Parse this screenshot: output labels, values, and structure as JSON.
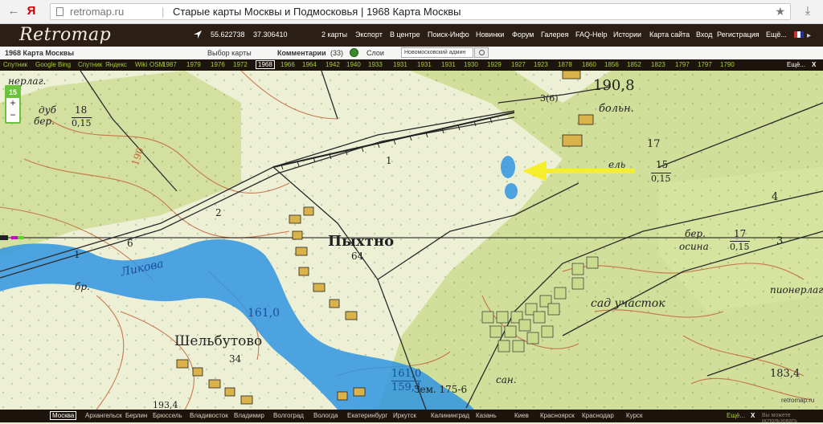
{
  "browser": {
    "back": "←",
    "yandex_logo": "Я",
    "refresh": "↻",
    "domain": "retromap.ru",
    "title": "Старые карты Москвы и Подмосковья | 1968 Карта Москвы",
    "download": "⤓"
  },
  "header": {
    "logo": "Retromap",
    "lat": "55.622738",
    "lon": "37.306410",
    "menu": [
      "2 карты",
      "Экспорт",
      "В центре",
      "Поиск-Инфо",
      "Новинки",
      "Форум",
      "Галерея",
      "FAQ-Help",
      "Истории",
      "Карта сайта",
      "Вход",
      "Регистрация",
      "Ещё..."
    ]
  },
  "toolbar": {
    "map_name": "1968 Карта Москвы",
    "choose_map": "Выбор карты",
    "comments_label": "Комментарии",
    "comments_count": "(33)",
    "layers": "Слои",
    "search_value": "Новомосковский админ"
  },
  "years": [
    "Спутник",
    "Google",
    "Bing",
    "Спутник",
    "Яндекс",
    "Wiki",
    "OSM",
    "1987",
    "1979",
    "1976",
    "1972",
    "1968",
    "1966",
    "1964",
    "1942",
    "1940",
    "1933",
    "1931",
    "1931",
    "1931",
    "1930",
    "1929",
    "1927",
    "1923",
    "1878",
    "1860",
    "1856",
    "1852",
    "1823",
    "1797",
    "1797",
    "1790"
  ],
  "years_selected_index": 11,
  "years_more": "Ещё...",
  "years_close": "X",
  "zoom": {
    "level": "15",
    "plus": "+",
    "minus": "−"
  },
  "map_labels": {
    "pykhtno": "Пыхтно",
    "pykhtno_num": "64",
    "shelbutovo": "Шельбутово",
    "shelbutovo_num": "34",
    "likova": "Ликова",
    "sad": "сад участок",
    "pionerlag": "пионерлаг",
    "boln": "больн.",
    "elev_1908": "190,8",
    "elev_1834": "183,4",
    "elev_1610": "161,0",
    "elev_1610b": "161,0",
    "elev_1594": "159,4",
    "elev_193": "193,4",
    "zem": "Зем. 175-6",
    "dub_ber": "дуб",
    "ber": "бер.",
    "frac18": "18",
    "frac015": "0,15",
    "frac15": "15",
    "frac015b": "0,15",
    "frac17": "17",
    "frac015c": "0,15",
    "ber_osina": "бер.",
    "osina": "осина",
    "el": "ель",
    "num17": "17",
    "num190": "190",
    "num4": "4",
    "num3": "3",
    "num6": "6",
    "num1": "1",
    "num2": "2",
    "num1b": "1",
    "km36": "3(6)",
    "naplag": "нерлаг.",
    "san": "сан.",
    "ber_low": "бр."
  },
  "watermark": "retromap.ru",
  "cities": [
    "Москва",
    "Архангельск",
    "Берлин",
    "Брюссель",
    "Владивосток",
    "Владимир",
    "Волгоград",
    "Вологда",
    "Екатеринбург",
    "Иркутск",
    "Калининград",
    "Казань",
    "Киев",
    "Красноярск",
    "Краснодар",
    "Курск"
  ],
  "cities_selected_index": 0,
  "cities_more": "Ещё...",
  "cities_close": "X",
  "cities_note": "Вы можете использовать",
  "colors": {
    "header_bg": "#2b1f15",
    "bar_bg": "#1d150d",
    "year_link": "#a9c83e",
    "map_base": "#eef0d6",
    "forest": "#c9db8c",
    "water": "#2f95e0",
    "contour": "#c2663a",
    "arrow": "#f5ee2a"
  }
}
